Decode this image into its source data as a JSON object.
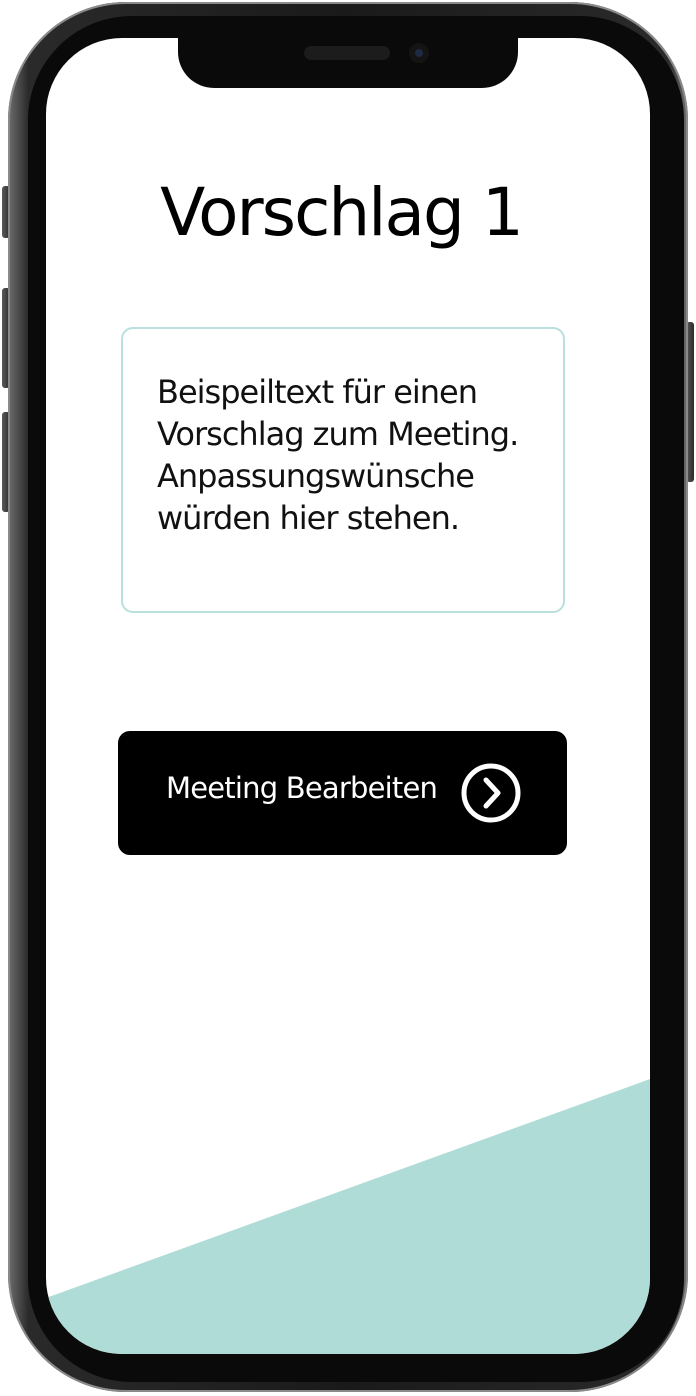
{
  "screen": {
    "title": "Vorschlag 1",
    "proposal_text": "Beispeiltext für einen Vorschlag zum Meeting. Anpassungswünsche würden hier stehen.",
    "edit_button_label": "Meeting Bearbeiten"
  },
  "icons": {
    "edit_button_icon": "chevron-right-circle-icon"
  },
  "colors": {
    "accent": "#b0dcd8",
    "card_border": "#b9e0dd",
    "button_background": "#000000",
    "button_text": "#ffffff"
  }
}
